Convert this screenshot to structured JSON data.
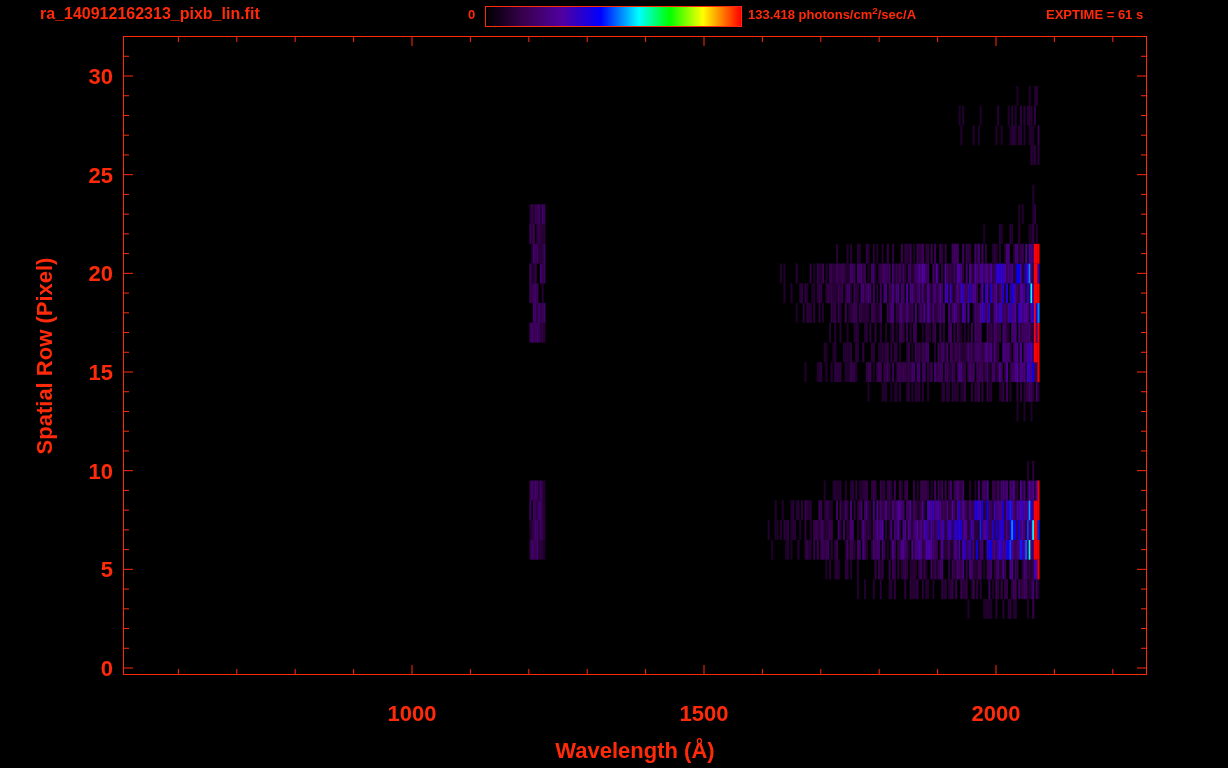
{
  "title": "ra_140912162313_pixb_lin.fit",
  "colorbar": {
    "min_label": "0",
    "max_label": "133.418 photons/cm$^{2}$/sec/A"
  },
  "exposure": "EXPTIME = 61 s",
  "y_axis": {
    "label": "Spatial Row (Pixel)",
    "ticks": [
      "30",
      "25",
      "20",
      "15",
      "10",
      "5",
      "0"
    ]
  },
  "x_axis": {
    "label": "Wavelength (Å)",
    "ticks": [
      "1000",
      "1500",
      "2000"
    ]
  }
}
